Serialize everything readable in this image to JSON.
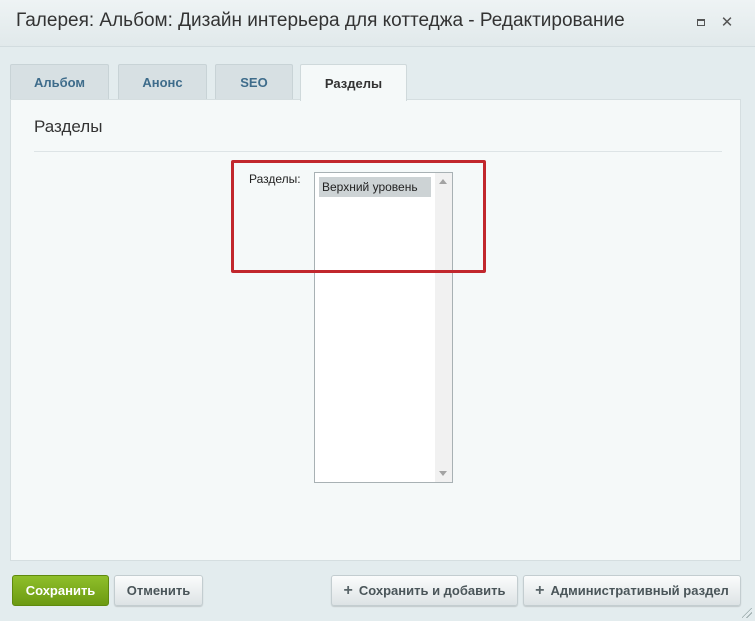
{
  "window": {
    "title": "Галерея: Альбом: Дизайн интерьера для коттеджа - Редактирование",
    "maximize_icon": "maximize-icon",
    "close_icon": "close-icon",
    "close_glyph": "✕"
  },
  "tabs": [
    {
      "label": "Альбом",
      "active": false
    },
    {
      "label": "Анонс",
      "active": false
    },
    {
      "label": "SEO",
      "active": false
    },
    {
      "label": "Разделы",
      "active": true
    }
  ],
  "section": {
    "title": "Разделы",
    "field_label": "Разделы:",
    "listbox": {
      "options": [
        "Верхний уровень"
      ],
      "selected": "Верхний уровень"
    }
  },
  "highlight_color": "#c1272d",
  "buttons": {
    "save": "Сохранить",
    "cancel": "Отменить",
    "save_and_add": "Сохранить и добавить",
    "admin_section": "Административный раздел",
    "plus_glyph": "+"
  },
  "colors": {
    "save_button": "#7aab1b",
    "active_tab_bg": "#f5f9f9",
    "tab_text": "#3e6c8b"
  }
}
